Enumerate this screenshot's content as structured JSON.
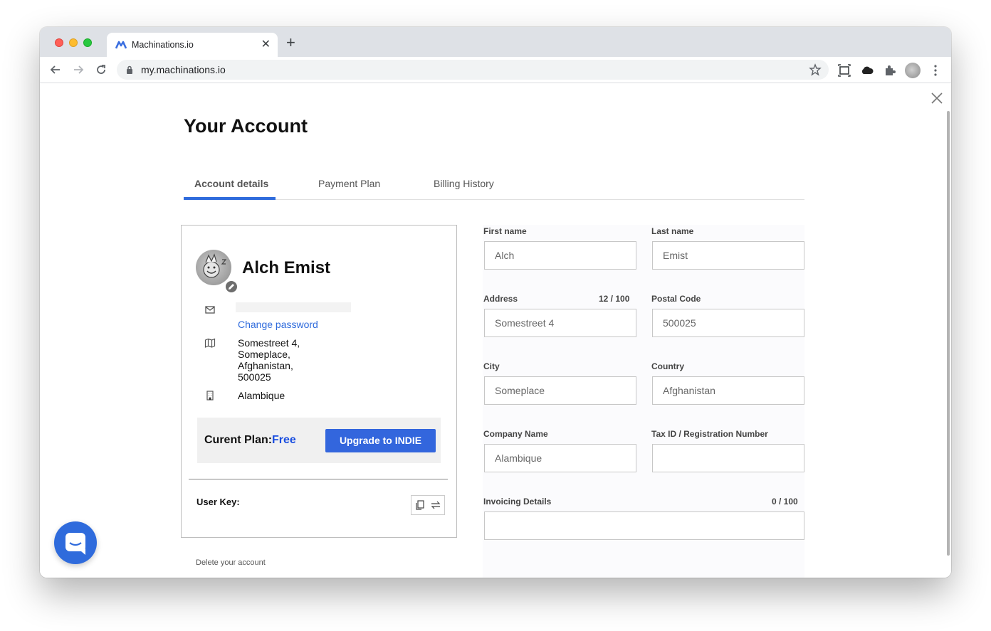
{
  "browser": {
    "tab_title": "Machinations.io",
    "url": "my.machinations.io"
  },
  "page": {
    "title": "Your Account",
    "tabs": [
      {
        "label": "Account details",
        "active": true
      },
      {
        "label": "Payment Plan",
        "active": false
      },
      {
        "label": "Billing History",
        "active": false
      }
    ]
  },
  "profile": {
    "name": "Alch Emist",
    "change_password": "Change password",
    "address": "Somestreet 4, Someplace, Afghanistan, 500025",
    "company": "Alambique",
    "plan_label": "Curent Plan:",
    "plan_value": "Free",
    "upgrade_button": "Upgrade to INDIE",
    "user_key_label": "User Key:",
    "delete_account": "Delete your account"
  },
  "form": {
    "first_name": {
      "label": "First name",
      "value": "Alch"
    },
    "last_name": {
      "label": "Last name",
      "value": "Emist"
    },
    "address": {
      "label": "Address",
      "counter": "12 / 100",
      "value": "Somestreet 4"
    },
    "postal_code": {
      "label": "Postal Code",
      "value": "500025"
    },
    "city": {
      "label": "City",
      "value": "Someplace"
    },
    "country": {
      "label": "Country",
      "value": "Afghanistan"
    },
    "company_name": {
      "label": "Company Name",
      "value": "Alambique"
    },
    "tax_id": {
      "label": "Tax ID / Registration Number",
      "value": ""
    },
    "invoicing": {
      "label": "Invoicing Details",
      "counter": "0 / 100",
      "value": ""
    }
  },
  "colors": {
    "accent": "#2f6bdc",
    "plan_value": "#1a4ee0"
  },
  "icons": [
    "machinations-logo-icon",
    "back-icon",
    "forward-icon",
    "reload-icon",
    "lock-icon",
    "bookmark-star-icon",
    "screenshot-icon",
    "cloud-icon",
    "extensions-icon",
    "profile-avatar-icon",
    "menu-icon",
    "close-icon",
    "mail-icon",
    "map-icon",
    "building-icon",
    "pencil-icon",
    "copy-icon",
    "regenerate-icon",
    "chat-icon"
  ]
}
